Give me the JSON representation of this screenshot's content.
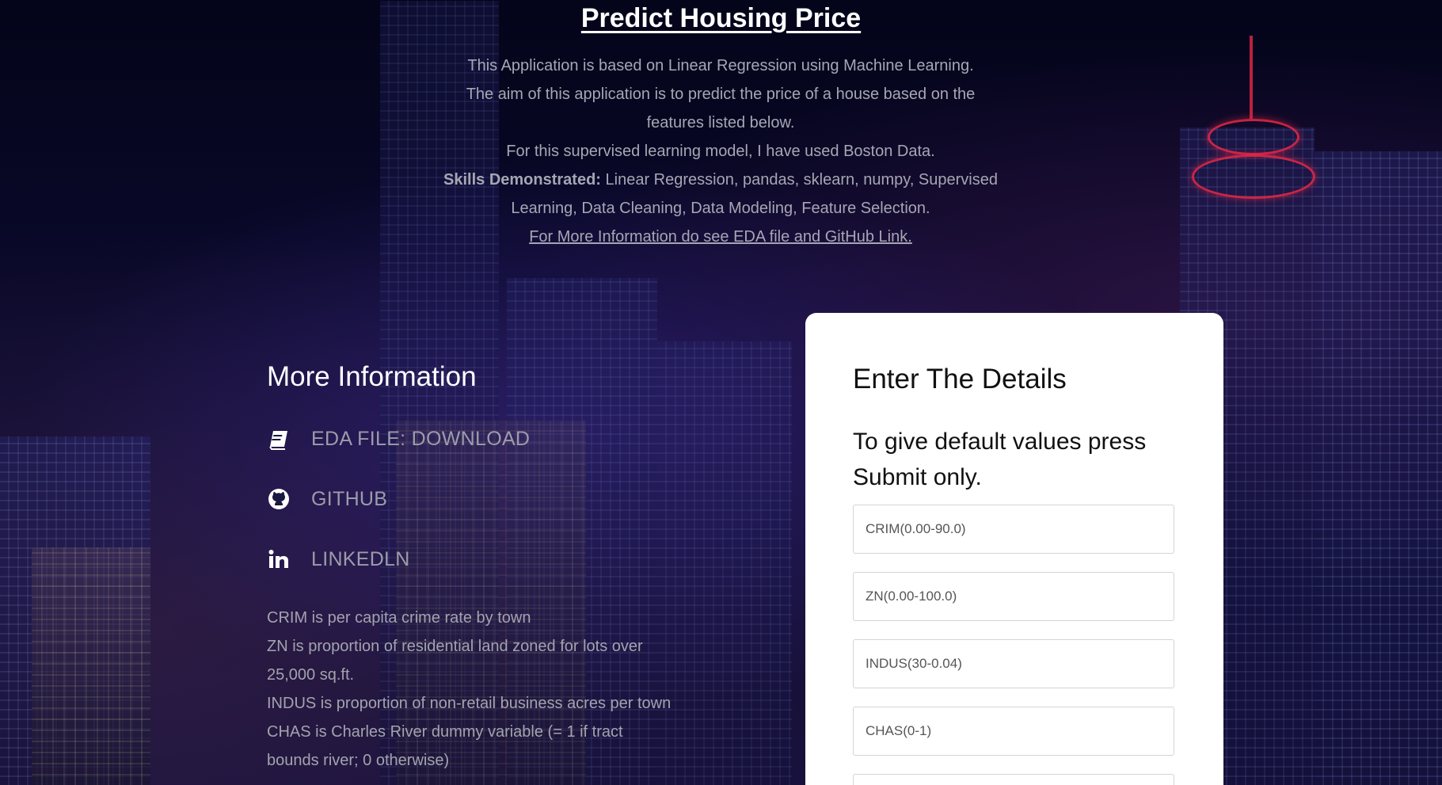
{
  "header": {
    "title": "Predict Housing Price",
    "lines": [
      "This Application is based on Linear Regression using Machine Learning.",
      "The aim of this application is to predict the price of a house based on the features listed below.",
      "For this supervised learning model, I have used Boston Data."
    ],
    "skills_label": "Skills Demonstrated:",
    "skills_text": " Linear Regression, pandas, sklearn, numpy, Supervised Learning, Data Cleaning, Data Modeling, Feature Selection.",
    "more_link": "For More Information do see EDA file and GitHub Link."
  },
  "more_info": {
    "heading": "More Information",
    "links": [
      {
        "label": "EDA FILE: DOWNLOAD",
        "icon": "book-icon"
      },
      {
        "label": "GITHUB",
        "icon": "github-icon"
      },
      {
        "label": "LINKEDLN",
        "icon": "linkedin-icon"
      }
    ],
    "descriptions": [
      "CRIM is per capita crime rate by town",
      "ZN is proportion of residential land zoned for lots over 25,000 sq.ft.",
      "INDUS is proportion of non-retail business acres per town",
      "CHAS is Charles River dummy variable (= 1 if tract bounds river; 0 otherwise)"
    ]
  },
  "form": {
    "heading": "Enter The Details",
    "subheading": "To give default values press Submit only.",
    "fields": [
      {
        "placeholder": "CRIM(0.00-90.0)",
        "value": ""
      },
      {
        "placeholder": "ZN(0.00-100.0)",
        "value": ""
      },
      {
        "placeholder": "INDUS(30-0.04)",
        "value": ""
      },
      {
        "placeholder": "CHAS(0-1)",
        "value": ""
      },
      {
        "placeholder": "",
        "value": ""
      }
    ]
  },
  "colors": {
    "background": "#06061a",
    "card": "#ffffff",
    "muted_text": "#a6a6b4",
    "accent_red": "#e62846"
  }
}
